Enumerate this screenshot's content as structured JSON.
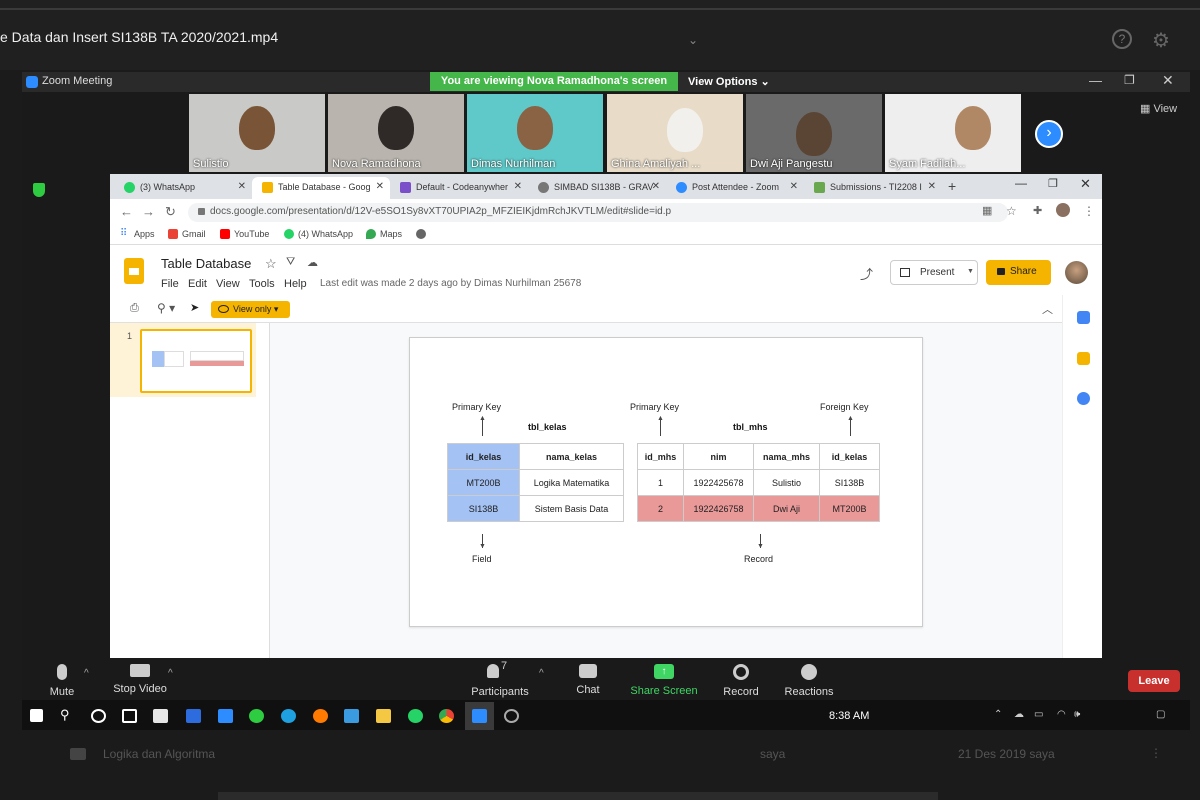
{
  "player": {
    "title": "e Data dan Insert SI138B TA 2020/2021.mp4"
  },
  "zoom": {
    "window_title": "Zoom Meeting",
    "banner": "You are viewing Nova Ramadhona's screen",
    "view_options": "View Options ⌄",
    "view_button": "View",
    "participants": [
      {
        "name": "Sulistio",
        "bg": "#c9cac7",
        "skin": "#7a5436"
      },
      {
        "name": "Nova Ramadhona",
        "bg": "#b9b5ae",
        "skin": "#2f2a28"
      },
      {
        "name": "Dimas Nurhilman",
        "bg": "#5fc8c8",
        "skin": "#8a6244"
      },
      {
        "name": "Ghina Amaliyah ...",
        "bg": "#e8dcc8",
        "skin": "#f2f0ec"
      },
      {
        "name": "Dwi Aji Pangestu",
        "bg": "#6a6a6a",
        "skin": "#5a4434"
      },
      {
        "name": "Syam Fadilah...",
        "bg": "#eeeeee",
        "skin": "#b08866"
      }
    ],
    "controls": {
      "mute": "Mute",
      "stop_video": "Stop Video",
      "participants": "Participants",
      "participants_count": "7",
      "chat": "Chat",
      "share_screen": "Share Screen",
      "record": "Record",
      "reactions": "Reactions",
      "leave": "Leave"
    }
  },
  "chrome": {
    "tabs": [
      {
        "label": "(3) WhatsApp",
        "color": "#25d366",
        "active": false
      },
      {
        "label": "Table Database - Goog",
        "color": "#f4b400",
        "active": true
      },
      {
        "label": "Default - Codeanywher",
        "color": "#7b4fc9",
        "active": false
      },
      {
        "label": "SIMBAD SI138B - GRAV",
        "color": "#777777",
        "active": false
      },
      {
        "label": "Post Attendee - Zoom",
        "color": "#2d8cff",
        "active": false
      },
      {
        "label": "Submissions - TI2208 I",
        "color": "#6aa84f",
        "active": false
      }
    ],
    "url": "docs.google.com/presentation/d/12V-e5SO1Sy8vXT70UPIA2p_MFZIEIKjdmRchJKVTLM/edit#slide=id.p",
    "bookmarks": [
      {
        "label": "Apps",
        "color": "#4285f4"
      },
      {
        "label": "Gmail",
        "color": "#ea4335"
      },
      {
        "label": "YouTube",
        "color": "#ff0000"
      },
      {
        "label": "(4) WhatsApp",
        "color": "#25d366"
      },
      {
        "label": "Maps",
        "color": "#34a853"
      },
      {
        "label": "",
        "color": "#666666"
      }
    ]
  },
  "slides": {
    "title": "Table Database",
    "menus": [
      "File",
      "Edit",
      "View",
      "Tools",
      "Help"
    ],
    "last_edit": "Last edit was made 2 days ago by Dimas Nurhilman 25678",
    "present": "Present",
    "share": "Share",
    "view_only": "View only",
    "slide_number": "1"
  },
  "slide_content": {
    "primary_key_1": "Primary Key",
    "primary_key_2": "Primary Key",
    "foreign_key": "Foreign Key",
    "tbl_kelas_title": "tbl_kelas",
    "tbl_mhs_title": "tbl_mhs",
    "field_label": "Field",
    "record_label": "Record",
    "tbl_kelas": {
      "headers": [
        "id_kelas",
        "nama_kelas"
      ],
      "rows": [
        [
          "MT200B",
          "Logika Matematika"
        ],
        [
          "SI138B",
          "Sistem Basis Data"
        ]
      ]
    },
    "tbl_mhs": {
      "headers": [
        "id_mhs",
        "nim",
        "nama_mhs",
        "id_kelas"
      ],
      "rows": [
        [
          "1",
          "1922425678",
          "Sulistio",
          "SI138B"
        ],
        [
          "2",
          "1922426758",
          "Dwi Aji",
          "MT200B"
        ]
      ]
    },
    "colors": {
      "field_highlight": "#a4c2f4",
      "record_highlight": "#ea9999"
    }
  },
  "taskbar": {
    "time": "8:38 AM"
  },
  "files": [
    {
      "name": "Logika dan Algoritma",
      "owner": "saya",
      "date": "21 Des 2019 saya"
    }
  ]
}
